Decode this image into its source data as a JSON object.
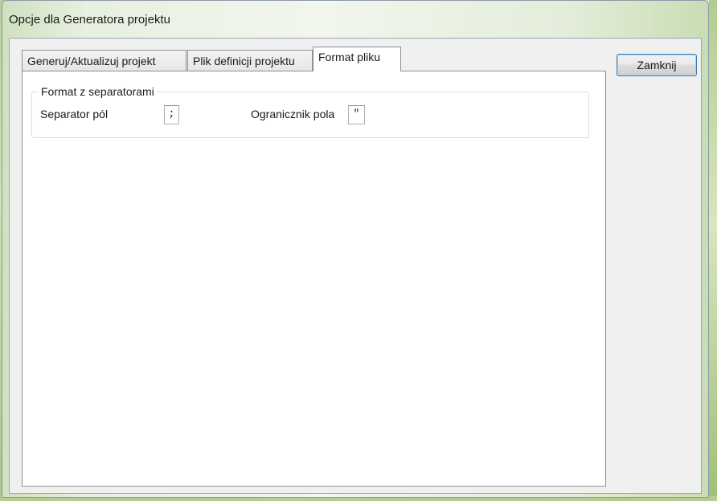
{
  "window": {
    "title": "Opcje dla Generatora projektu"
  },
  "tabs": [
    {
      "label": "Generuj/Aktualizuj projekt",
      "active": false
    },
    {
      "label": "Plik definicji projektu",
      "active": false
    },
    {
      "label": "Format pliku",
      "active": true
    }
  ],
  "format_group": {
    "legend": "Format z separatorami",
    "field_separator_label": "Separator pól",
    "field_separator_value": ";",
    "field_delimiter_label": "Ogranicznik pola",
    "field_delimiter_value": "\""
  },
  "buttons": {
    "close_label": "Zamknij"
  }
}
